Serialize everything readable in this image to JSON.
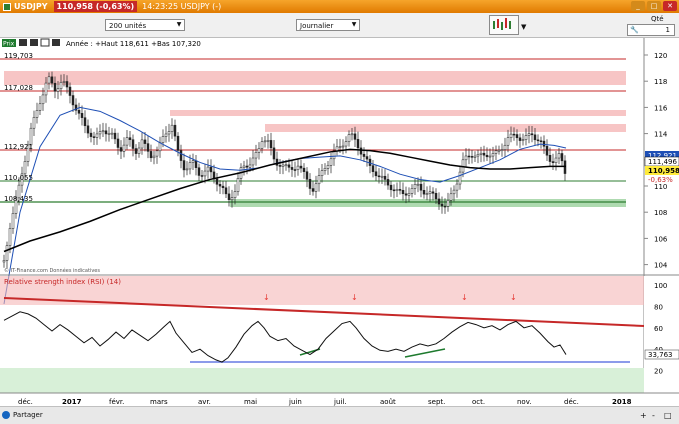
{
  "window": {
    "symbol": "USDJPY",
    "price_badge": "110,958 (-0,63%)",
    "title_suffix": "14:23:25 USDJPY (-)"
  },
  "toolbar": {
    "units": "200 unités",
    "period": "Journalier",
    "qty_label": "Qté",
    "qty_value": "1"
  },
  "chart": {
    "pill": "Prix",
    "header": "Année : +Haut 118,611 +Bas 107,320",
    "hlines": [
      "119,703",
      "117,028",
      "112,921",
      "110,055",
      "108,435"
    ],
    "price_ticks": [
      "120",
      "118",
      "116",
      "114",
      "112",
      "110",
      "108",
      "106",
      "104"
    ],
    "tags": {
      "ma": "112,921",
      "black": "111,496",
      "last": "110,958",
      "pct": "-0,63%"
    },
    "credit": "© IT-Finance.com Données indicatives",
    "rsi_title": "Relative strength index (RSI) (14)",
    "rsi_ticks": [
      "100",
      "80",
      "60",
      "40",
      "20"
    ],
    "rsi_value": "33,763",
    "months": [
      "déc.",
      "2017",
      "févr.",
      "mars",
      "avr.",
      "mai",
      "juin",
      "juil.",
      "août",
      "sept.",
      "oct.",
      "nov.",
      "déc.",
      "2018"
    ]
  },
  "footer": {
    "share": "Partager",
    "zoom_plus": "+",
    "zoom_minus": "-",
    "zoom_box": "□"
  }
}
